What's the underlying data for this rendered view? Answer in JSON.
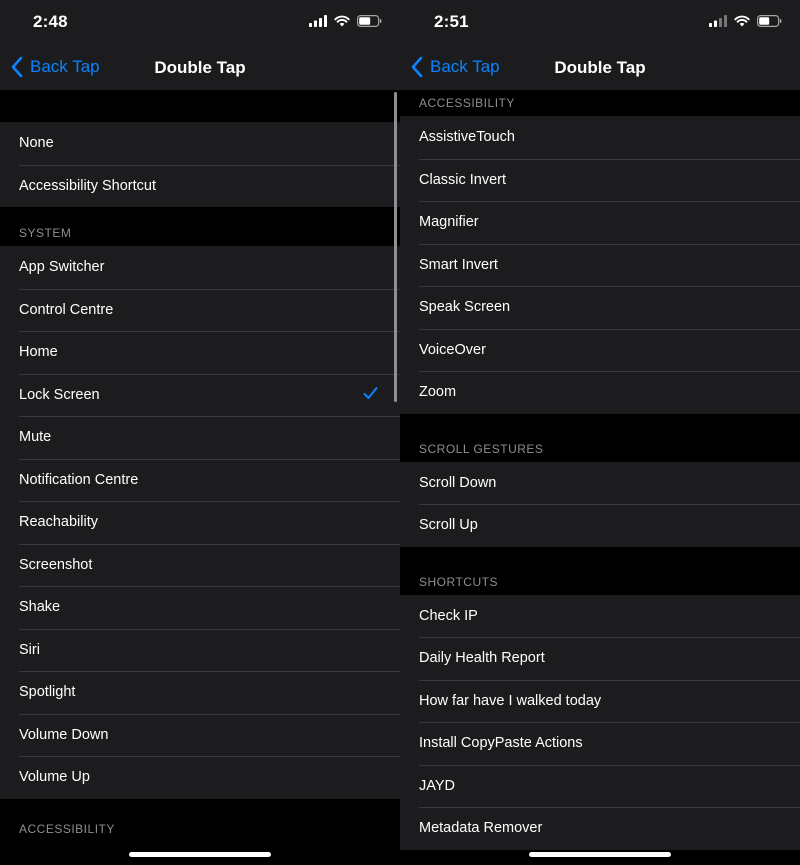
{
  "left": {
    "time": "2:48",
    "back_label": "Back Tap",
    "title": "Double Tap",
    "group1": [
      "None",
      "Accessibility Shortcut"
    ],
    "system_header": "SYSTEM",
    "system_items": [
      "App Switcher",
      "Control Centre",
      "Home",
      "Lock Screen",
      "Mute",
      "Notification Centre",
      "Reachability",
      "Screenshot",
      "Shake",
      "Siri",
      "Spotlight",
      "Volume Down",
      "Volume Up"
    ],
    "selected": "Lock Screen",
    "accessibility_header": "ACCESSIBILITY"
  },
  "right": {
    "time": "2:51",
    "back_label": "Back Tap",
    "title": "Double Tap",
    "accessibility_header": "ACCESSIBILITY",
    "accessibility_items": [
      "AssistiveTouch",
      "Classic Invert",
      "Magnifier",
      "Smart Invert",
      "Speak Screen",
      "VoiceOver",
      "Zoom"
    ],
    "scroll_header": "SCROLL GESTURES",
    "scroll_items": [
      "Scroll Down",
      "Scroll Up"
    ],
    "shortcuts_header": "SHORTCUTS",
    "shortcuts_items": [
      "Check IP",
      "Daily Health Report",
      "How far have I walked today",
      "Install CopyPaste Actions",
      "JAYD",
      "Metadata Remover"
    ]
  },
  "colors": {
    "accent": "#0a84ff",
    "background": "#000000",
    "cell": "#1c1c1e",
    "secondary_text": "#8e8e93"
  },
  "icons": {
    "back": "chevron-left-icon",
    "check": "checkmark-icon",
    "signal": "cellular-signal-icon",
    "wifi": "wifi-icon",
    "battery": "battery-icon"
  }
}
